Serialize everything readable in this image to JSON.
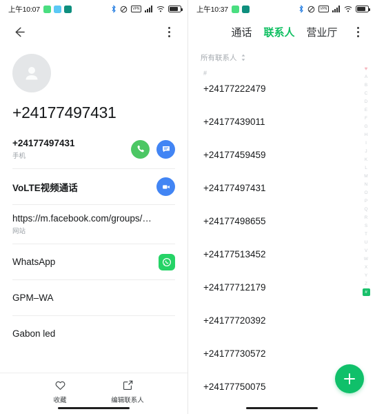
{
  "left": {
    "status": {
      "time": "上午10:07",
      "app_icons": [
        "whatsapp-green",
        "telegram-blue",
        "app-teal"
      ],
      "system_icons": [
        "bluetooth-icon",
        "dnd-icon",
        "vpn-icon",
        "signal-icon",
        "wifi-icon",
        "battery-icon"
      ]
    },
    "topbar": {
      "back": "back-arrow",
      "menu": "overflow-menu"
    },
    "contact_name": "+24177497431",
    "rows": [
      {
        "primary": "+24177497431",
        "sub": "手机",
        "bold": true,
        "actions": [
          "call",
          "message"
        ]
      },
      {
        "primary": "VoLTE视频通话",
        "sub": "",
        "bold": false,
        "actions": [
          "video"
        ]
      },
      {
        "primary": "https://m.facebook.com/groups/…",
        "sub": "网站",
        "bold": false,
        "actions": []
      },
      {
        "primary": "WhatsApp",
        "sub": "",
        "bold": false,
        "actions": [
          "whatsapp"
        ]
      },
      {
        "primary": "GPM–WA",
        "sub": "",
        "bold": false,
        "actions": []
      },
      {
        "primary": "Gabon led",
        "sub": "",
        "bold": false,
        "actions": []
      }
    ],
    "bottom": [
      {
        "icon": "heart-icon",
        "label": "收藏"
      },
      {
        "icon": "edit-icon",
        "label": "编辑联系人"
      }
    ]
  },
  "right": {
    "status": {
      "time": "上午10:37",
      "app_icons": [
        "whatsapp-green",
        "app-teal"
      ],
      "system_icons": [
        "bluetooth-icon",
        "dnd-icon",
        "vpn-icon",
        "signal-icon",
        "wifi-icon",
        "battery-icon"
      ]
    },
    "tabs": [
      {
        "label": "通话",
        "active": false
      },
      {
        "label": "联系人",
        "active": true
      },
      {
        "label": "营业厅",
        "active": false
      }
    ],
    "menu": "overflow-menu",
    "filter": {
      "label": "所有联系人",
      "icon": "sort-chevron-icon"
    },
    "section_letter": "#",
    "contacts": [
      "+24177222479",
      "+24177439011",
      "+24177459459",
      "+24177497431",
      "+24177498655",
      "+24177513452",
      "+24177712179",
      "+24177720392",
      "+24177730572",
      "+24177750075"
    ],
    "alpha_index": [
      "♥",
      "A",
      "B",
      "C",
      "D",
      "E",
      "F",
      "G",
      "H",
      "I",
      "J",
      "K",
      "L",
      "M",
      "N",
      "O",
      "P",
      "Q",
      "R",
      "S",
      "T",
      "U",
      "V",
      "W",
      "X",
      "Y",
      "Z",
      "#"
    ],
    "alpha_selected": "#",
    "fab": "add-contact-button"
  },
  "colors": {
    "accent_green": "#0fbf61",
    "fab_green": "#10c06a",
    "call_green": "#4cc764",
    "message_blue": "#4285f4",
    "video_blue": "#4285f4",
    "whatsapp_green": "#25d366",
    "text_primary": "#16181a",
    "text_muted": "#9aa0a6",
    "divider": "#ececec",
    "avatar_bg": "#e4e6e8",
    "index_inactive": "#cfd3d7",
    "heart_pink": "#f6b8c0"
  }
}
